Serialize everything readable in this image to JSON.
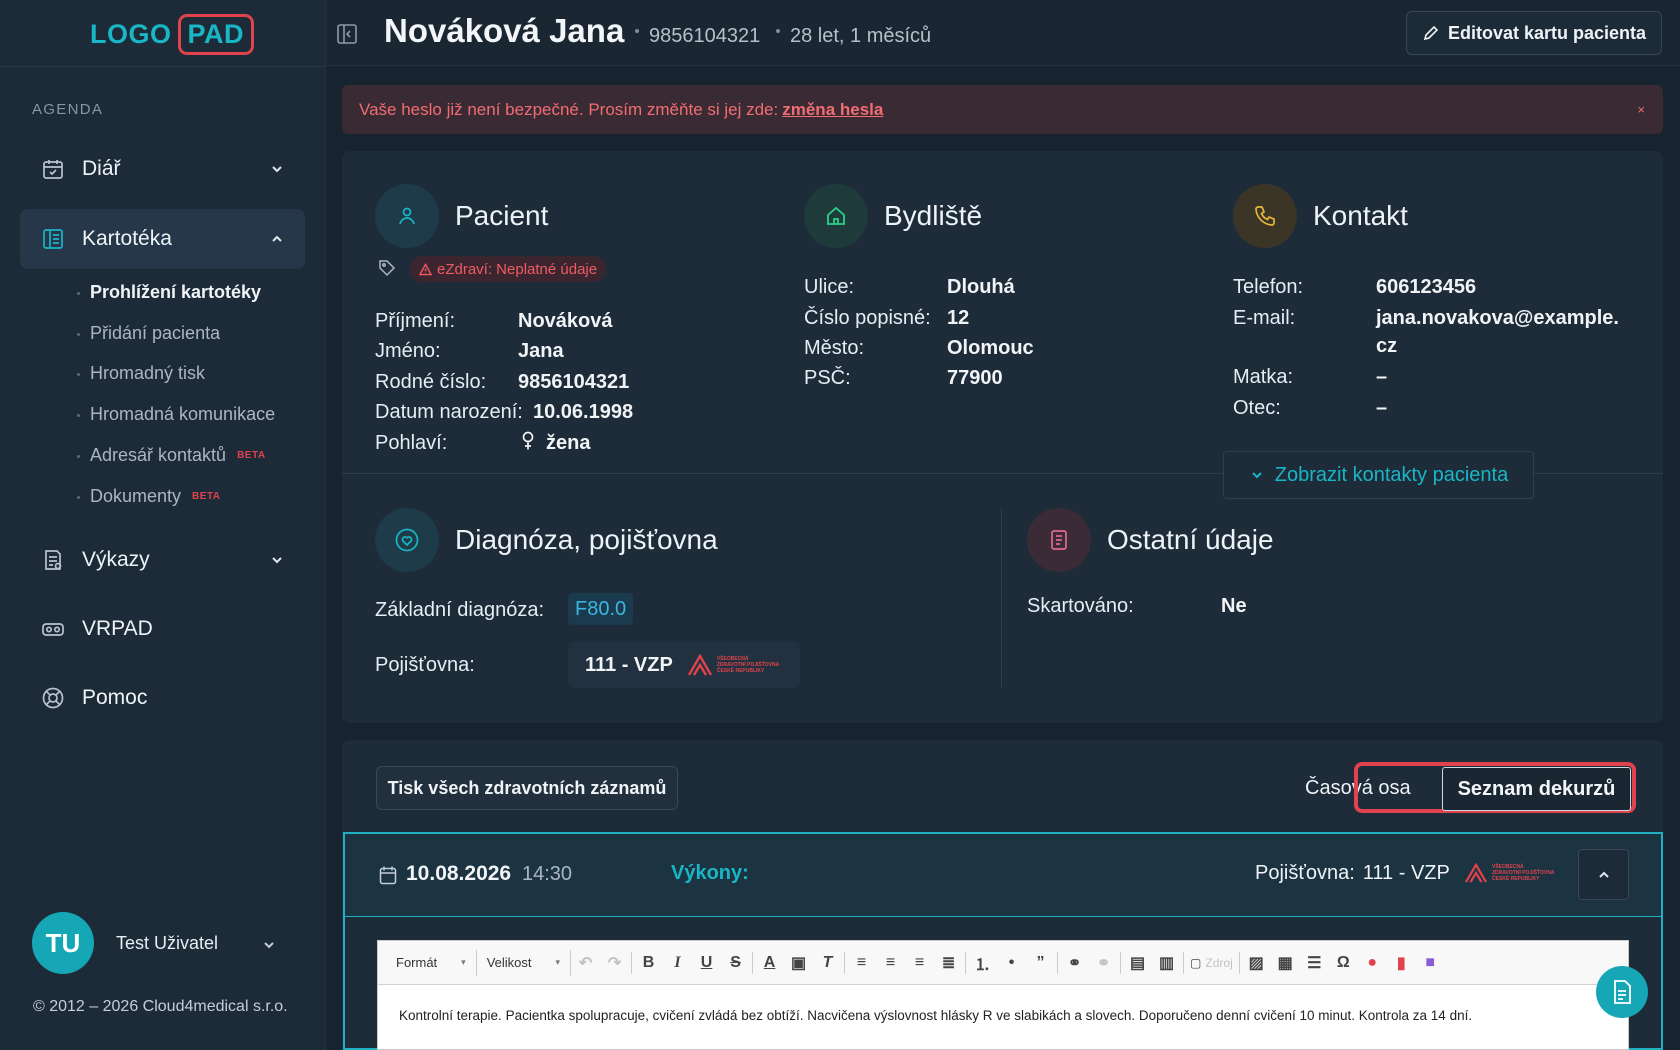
{
  "logo": {
    "part1": "LOGO",
    "part2": "PAD"
  },
  "sidebar": {
    "section_title": "AGENDA",
    "items": [
      {
        "label": "Diář",
        "icon": "calendar-icon"
      },
      {
        "label": "Kartotéka",
        "icon": "card-index-icon"
      },
      {
        "label": "Výkazy",
        "icon": "report-icon"
      },
      {
        "label": "VRPAD",
        "icon": "vr-headset-icon"
      },
      {
        "label": "Pomoc",
        "icon": "lifebuoy-icon"
      }
    ],
    "subitems": [
      {
        "label": "Prohlížení kartotéky",
        "badge": ""
      },
      {
        "label": "Přidání pacienta",
        "badge": ""
      },
      {
        "label": "Hromadný tisk",
        "badge": ""
      },
      {
        "label": "Hromadná komunikace",
        "badge": ""
      },
      {
        "label": "Adresář kontaktů",
        "badge": "BETA"
      },
      {
        "label": "Dokumenty",
        "badge": "BETA"
      }
    ],
    "user": {
      "initials": "TU",
      "name": "Test Uživatel"
    },
    "copyright": "© 2012 – 2026 Cloud4medical s.r.o."
  },
  "header": {
    "patient_name": "Nováková Jana",
    "birth_number": "9856104321",
    "age": "28 let, 1 měsíců",
    "edit_label": "Editovat kartu pacienta"
  },
  "alert": {
    "text": "Vaše heslo již není bezpečné. Prosím změňte si jej zde:",
    "link": "změna hesla",
    "close": "×"
  },
  "patient": {
    "title": "Pacient",
    "warning": "eZdraví: Neplatné údaje",
    "fields": [
      {
        "label": "Příjmení:",
        "value": "Nováková"
      },
      {
        "label": "Jméno:",
        "value": "Jana"
      },
      {
        "label": "Rodné číslo:",
        "value": "9856104321"
      },
      {
        "label": "Datum narození:",
        "value": "10.06.1998"
      },
      {
        "label": "Pohlaví:",
        "value": "žena"
      }
    ]
  },
  "address": {
    "title": "Bydliště",
    "fields": [
      {
        "label": "Ulice:",
        "value": "Dlouhá"
      },
      {
        "label": "Číslo popisné:",
        "value": "12"
      },
      {
        "label": "Město:",
        "value": "Olomouc"
      },
      {
        "label": "PSČ:",
        "value": "77900"
      }
    ]
  },
  "contact": {
    "title": "Kontakt",
    "fields": [
      {
        "label": "Telefon:",
        "value": "606123456"
      },
      {
        "label": "E-mail:",
        "value": "jana.novakova@example.",
        "value2": "cz"
      },
      {
        "label": "Matka:",
        "value": "–"
      },
      {
        "label": "Otec:",
        "value": "–"
      }
    ],
    "show_button": "Zobrazit kontakty pacienta"
  },
  "diagnosis": {
    "title": "Diagnóza, pojišťovna",
    "diag_label": "Základní diagnóza:",
    "diag_value": "F80.0",
    "ins_label": "Pojišťovna:",
    "ins_value": "111 - VZP",
    "ins_logo_text": [
      "VŠEOBECNÁ",
      "ZDRAVOTNÍ POJIŠŤOVNA",
      "ČESKÉ REPUBLIKY"
    ]
  },
  "other": {
    "title": "Ostatní údaje",
    "label": "Skartováno:",
    "value": "Ne"
  },
  "records": {
    "print_button": "Tisk všech zdravotních záznamů",
    "tab_timeline": "Časová osa",
    "tab_list": "Seznam dekurzů",
    "entry": {
      "date": "10.08.2026",
      "time": "14:30",
      "services_label": "Výkony:",
      "ins_label": "Pojišťovna:",
      "ins_value": "111 - VZP"
    },
    "editor": {
      "format": "Formát",
      "size": "Velikost",
      "source": "Zdroj",
      "text": "Kontrolní terapie. Pacientka spolupracuje, cvičení zvládá bez obtíží. Nacvičena výslovnost hlásky R ve slabikách a slovech. Doporučeno denní cvičení 10 minut. Kontrola za 14 dní."
    }
  },
  "colors": {
    "accent": "#19b6c6",
    "danger": "#e0434d",
    "bg": "#17232f",
    "panel": "#1e2b38"
  }
}
